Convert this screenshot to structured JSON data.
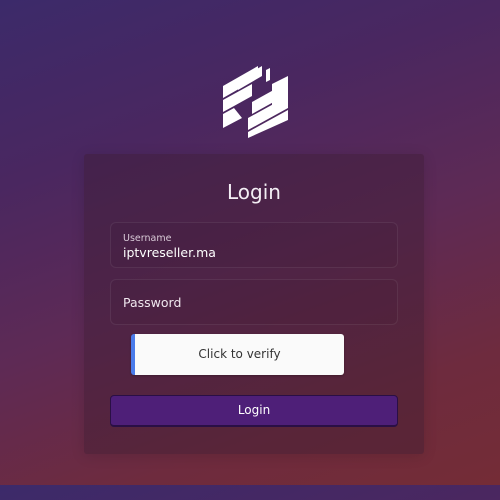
{
  "login": {
    "title": "Login",
    "username": {
      "label": "Username",
      "value": "iptvreseller.ma"
    },
    "password": {
      "placeholder": "Password"
    },
    "captcha": {
      "label": "Click to verify",
      "accent_color": "#4a7bea"
    },
    "submit_label": "Login"
  },
  "logo": {
    "icon": "brand-logo-icon",
    "color": "#ffffff"
  },
  "colors": {
    "background_top": "#3c2a6a",
    "background_bottom": "#742c36",
    "button": "#4e1f78"
  }
}
